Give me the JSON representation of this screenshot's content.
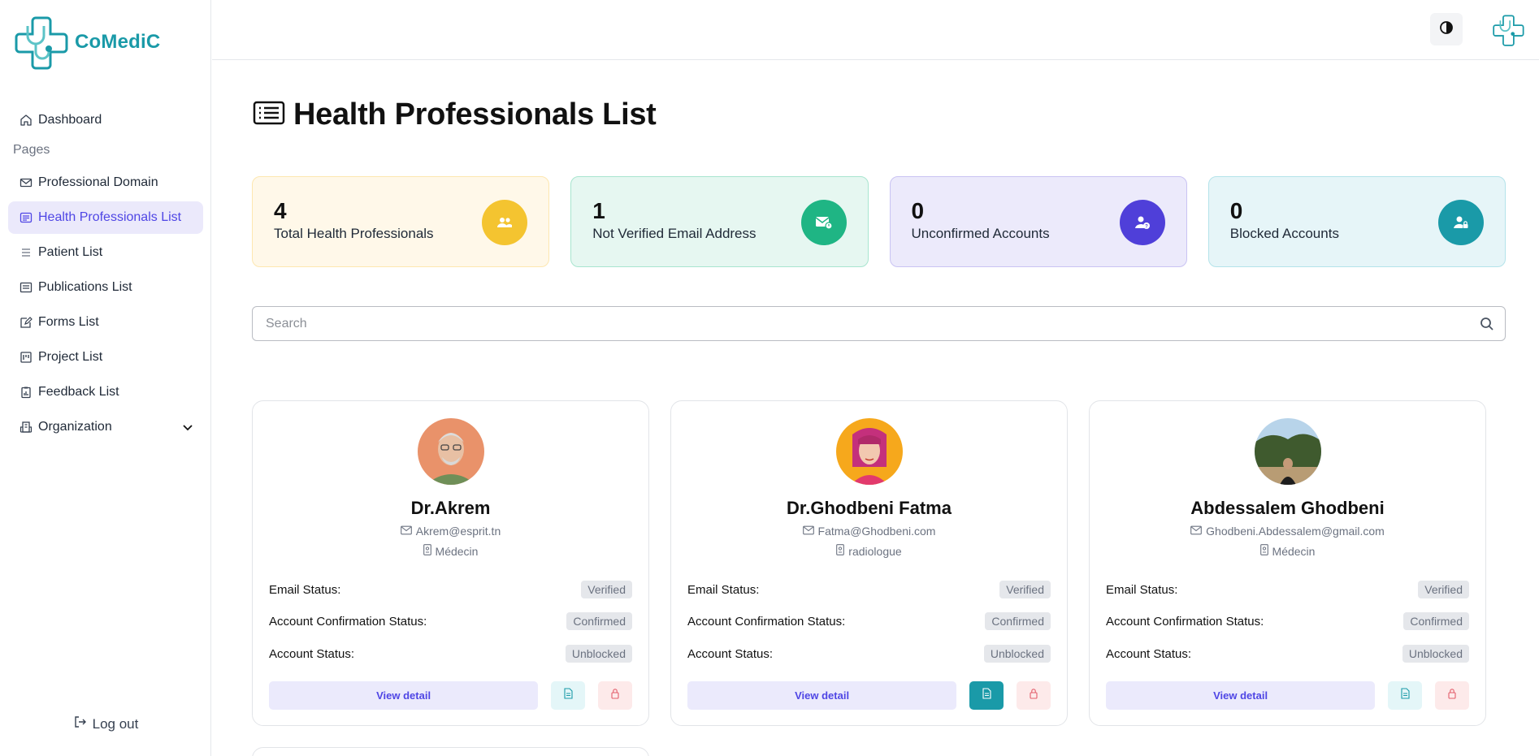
{
  "app": {
    "name": "CoMedic",
    "logo_text": "CoMediC"
  },
  "sidebar": {
    "items": [
      {
        "label": "Dashboard",
        "icon": "home-icon"
      },
      {
        "section": "Pages"
      },
      {
        "label": "Professional Domain",
        "icon": "mail-icon"
      },
      {
        "label": "Health Professionals List",
        "icon": "list-icon",
        "active": true
      },
      {
        "label": "Patient List",
        "icon": "menu-icon"
      },
      {
        "label": "Publications List",
        "icon": "news-icon"
      },
      {
        "label": "Forms List",
        "icon": "edit-icon"
      },
      {
        "label": "Project List",
        "icon": "kanban-icon"
      },
      {
        "label": "Feedback List",
        "icon": "clipboard-chart-icon"
      },
      {
        "label": "Organization",
        "icon": "building-icon"
      }
    ],
    "logout_label": "Log out"
  },
  "page": {
    "title": "Health Professionals List"
  },
  "stats": [
    {
      "value": "4",
      "label": "Total Health Professionals",
      "color": "#f4c430"
    },
    {
      "value": "1",
      "label": "Not Verified Email Address",
      "color": "#1fb584"
    },
    {
      "value": "0",
      "label": "Unconfirmed Accounts",
      "color": "#4f3fd9"
    },
    {
      "value": "0",
      "label": "Blocked Accounts",
      "color": "#1a9aa8"
    }
  ],
  "search": {
    "placeholder": "Search"
  },
  "cards": [
    {
      "name": "Dr.Akrem",
      "email": "Akrem@esprit.tn",
      "role": "Médecin",
      "email_status_label": "Email Status:",
      "email_status": "Verified",
      "confirmation_label": "Account Confirmation Status:",
      "confirmation_status": "Confirmed",
      "account_label": "Account Status:",
      "account_status": "Unblocked",
      "view_label": "View detail"
    },
    {
      "name": "Dr.Ghodbeni Fatma",
      "email": "Fatma@Ghodbeni.com",
      "role": "radiologue",
      "email_status_label": "Email Status:",
      "email_status": "Verified",
      "confirmation_label": "Account Confirmation Status:",
      "confirmation_status": "Confirmed",
      "account_label": "Account Status:",
      "account_status": "Unblocked",
      "view_label": "View detail"
    },
    {
      "name": "Abdessalem Ghodbeni",
      "email": "Ghodbeni.Abdessalem@gmail.com",
      "role": "Médecin",
      "email_status_label": "Email Status:",
      "email_status": "Verified",
      "confirmation_label": "Account Confirmation Status:",
      "confirmation_status": "Confirmed",
      "account_label": "Account Status:",
      "account_status": "Unblocked",
      "view_label": "View detail"
    }
  ],
  "colors": {
    "accent": "#4f46e5",
    "brand": "#1a9aa8"
  }
}
